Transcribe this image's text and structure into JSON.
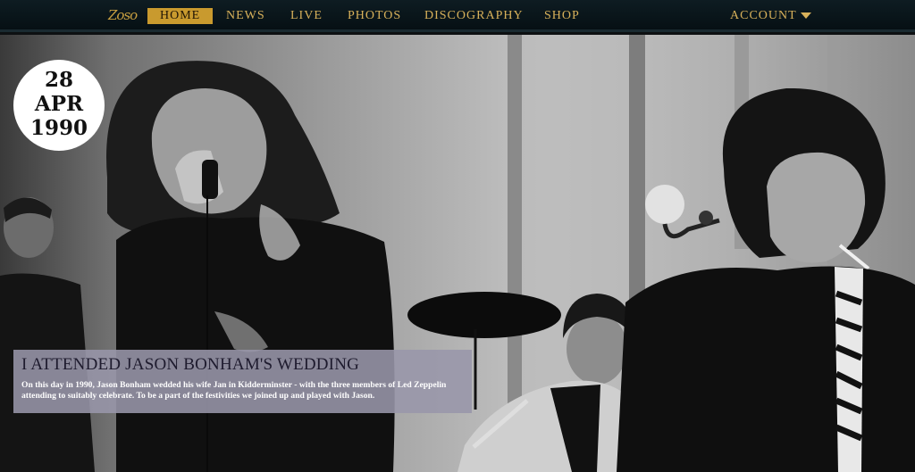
{
  "nav": {
    "logo_text": "Zoso",
    "items": [
      {
        "label": "HOME",
        "active": true
      },
      {
        "label": "NEWS",
        "active": false
      },
      {
        "label": "LIVE",
        "active": false
      },
      {
        "label": "PHOTOS",
        "active": false
      },
      {
        "label": "DISCOGRAPHY",
        "active": false
      },
      {
        "label": "SHOP",
        "active": false
      }
    ],
    "account_label": "ACCOUNT",
    "accent_color": "#c99a2e"
  },
  "date_badge": {
    "day": "28",
    "month": "APR",
    "year": "1990"
  },
  "caption": {
    "title": "I ATTENDED JASON BONHAM'S WEDDING",
    "text": "On this day in 1990, Jason Bonham wedded his wife Jan in Kidderminster - with the three members of Led Zeppelin attending to suitably celebrate. To be a part of the festivities we joined up and played with Jason."
  }
}
